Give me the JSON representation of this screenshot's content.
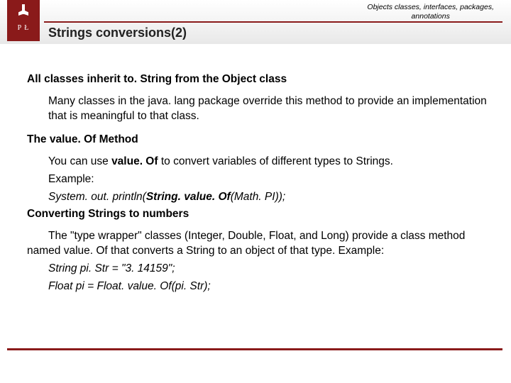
{
  "header": {
    "breadcrumb_line1": "Objects classes, interfaces, packages,",
    "breadcrumb_line2": "annotations",
    "logo_letters": "P   Ł",
    "title": "Strings conversions(2)"
  },
  "content": {
    "section1_heading": "All classes inherit to. String from the Object class",
    "section1_body": "Many classes in the java. lang package override this method to provide an implementation that is meaningful to that class.",
    "section2_heading": "The value. Of Method",
    "section2_line1_a": "You can use ",
    "section2_line1_b": "value. Of",
    "section2_line1_c": " to convert variables of different types to Strings.",
    "section2_line2": "Example:",
    "section2_line3_a": "System. out. println(",
    "section2_line3_b": "String. value. Of",
    "section2_line3_c": "(Math. PI));",
    "section3_heading": "Converting Strings to numbers",
    "section3_body": "The \"type wrapper\" classes (Integer, Double, Float, and  Long) provide a class method named value. Of that converts a String to an object of that type.  Example:",
    "section3_code1": "String pi. Str = \"3. 14159\";",
    "section3_code2": "Float pi = Float. value. Of(pi. Str);"
  }
}
